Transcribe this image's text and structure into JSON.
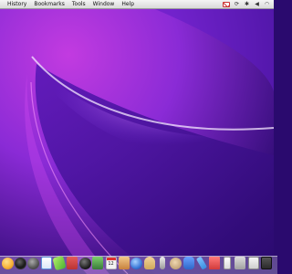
{
  "menubar": {
    "items": [
      "History",
      "Bookmarks",
      "Tools",
      "Window",
      "Help"
    ],
    "status_icons": [
      "gmail-icon",
      "sync-icon",
      "bluetooth-icon",
      "volume-icon",
      "wifi-icon"
    ]
  },
  "desktop": {
    "wallpaper_colors": {
      "top_left": "#c23be0",
      "top_right": "#6a2ad0",
      "center": "#3b13a8",
      "glow": "#f4d6ff",
      "bottom": "#2a0a6e"
    }
  },
  "dock": {
    "apps": [
      {
        "name": "finder",
        "icon": "finder-icon",
        "color": "#f7b33b"
      },
      {
        "name": "dashboard",
        "icon": "dashboard-icon",
        "color": "#1b1b1b"
      },
      {
        "name": "ichat",
        "icon": "chat-icon",
        "color": "#4c4c4c"
      },
      {
        "name": "mail",
        "icon": "mail-icon",
        "color": "#5a8fd8"
      },
      {
        "name": "green-app",
        "icon": "green-app-icon",
        "color": "#49b030"
      },
      {
        "name": "address-book",
        "icon": "address-book-icon",
        "color": "#b33"
      },
      {
        "name": "camino",
        "icon": "globe-icon",
        "color": "#2a2a2a"
      },
      {
        "name": "utilities",
        "icon": "utilities-icon",
        "color": "#3a7a3a"
      },
      {
        "name": "ical",
        "icon": "calendar-icon",
        "color": "#f3f3f3",
        "text": "12"
      },
      {
        "name": "iphoto",
        "icon": "photo-icon",
        "color": "#c7813d"
      },
      {
        "name": "safari",
        "icon": "safari-icon",
        "color": "#3b79d9"
      },
      {
        "name": "garageband",
        "icon": "guitar-icon",
        "color": "#d0a85a"
      },
      {
        "name": "microphone",
        "icon": "microphone-icon",
        "color": "#9a9a9a"
      },
      {
        "name": "mask",
        "icon": "mask-icon",
        "color": "#c2a378"
      },
      {
        "name": "blue-app",
        "icon": "blue-app-icon",
        "color": "#2e67c9"
      },
      {
        "name": "pencil",
        "icon": "pencil-icon",
        "color": "#3a8fe0"
      },
      {
        "name": "flag",
        "icon": "flag-icon",
        "color": "#d23b3b"
      },
      {
        "name": "ipod",
        "icon": "ipod-icon",
        "color": "#dcdcdc"
      },
      {
        "name": "ppt",
        "icon": "presentation-icon",
        "color": "#a0a0a0"
      },
      {
        "name": "tv",
        "icon": "display-icon",
        "color": "#cfcfcf"
      },
      {
        "name": "terminal",
        "icon": "terminal-icon",
        "color": "#2a2a2a"
      }
    ]
  }
}
